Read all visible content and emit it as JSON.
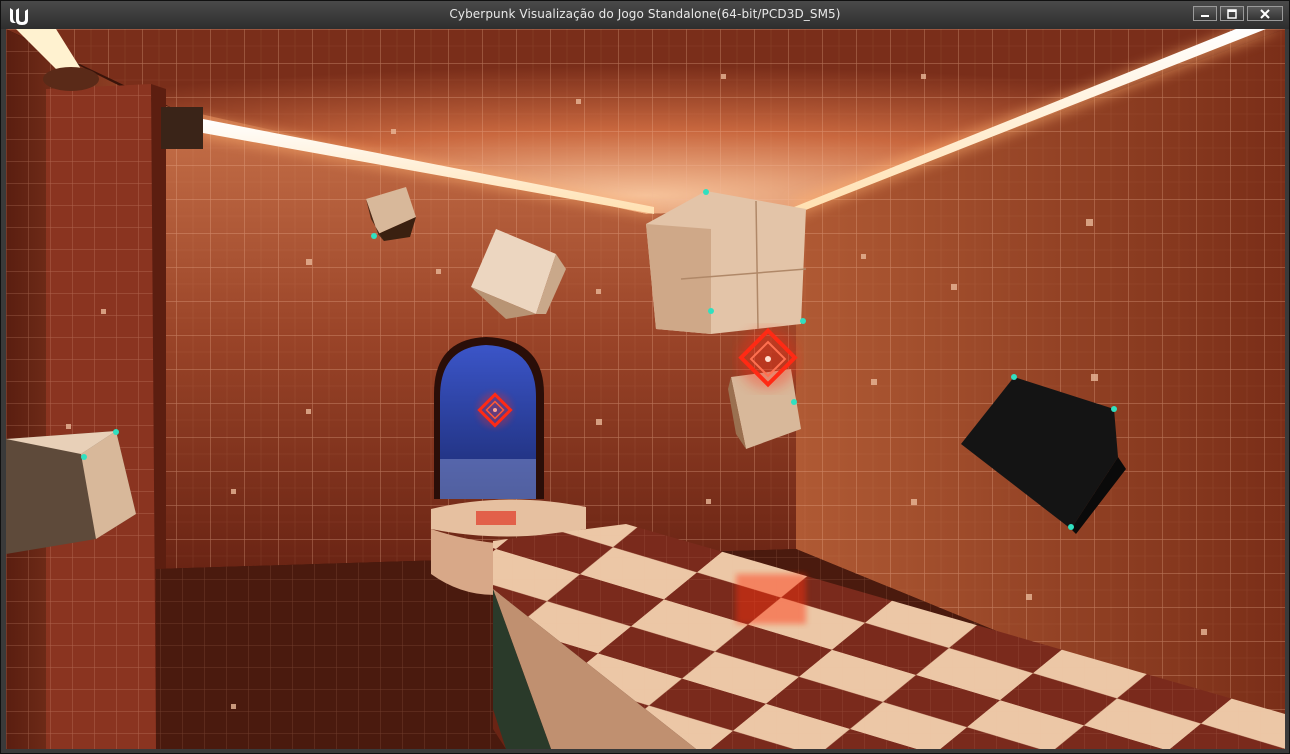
{
  "window": {
    "title": "Cyberpunk Visualização do Jogo Standalone(64-bit/PCD3D_SM5)",
    "app_icon": "unreal-engine-logo-icon",
    "buttons": [
      "minimize-icon",
      "maximize-icon",
      "close-icon"
    ]
  },
  "viewport": {
    "scene": "game-render",
    "colors": {
      "wall": "#8a3a22",
      "grid": "#f0b08a",
      "light": "#fff4d8",
      "tile_light": "#e9c3a0",
      "tile_dark": "#7a2a1c",
      "cube": "#d8b89a",
      "target": "#ff2a14",
      "doorway": "#2a3d9a"
    }
  }
}
